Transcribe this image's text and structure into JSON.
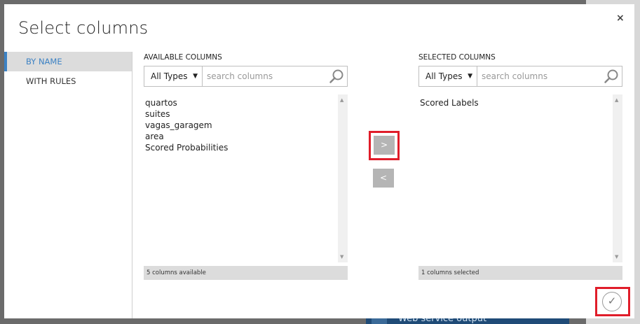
{
  "dialog": {
    "title": "Select columns",
    "close_glyph": "×"
  },
  "sidebar": {
    "items": [
      {
        "label": "BY NAME",
        "active": true
      },
      {
        "label": "WITH RULES",
        "active": false
      }
    ]
  },
  "available": {
    "heading": "AVAILABLE COLUMNS",
    "type_filter": "All Types",
    "search_placeholder": "search columns",
    "items": [
      "quartos",
      "suites",
      "vagas_garagem",
      "area",
      "Scored Probabilities"
    ],
    "status": "5 columns available"
  },
  "selected": {
    "heading": "SELECTED COLUMNS",
    "type_filter": "All Types",
    "search_placeholder": "search columns",
    "items": [
      "Scored Labels"
    ],
    "status": "1 columns selected"
  },
  "controls": {
    "add_label": ">",
    "remove_label": "<",
    "ok_glyph": "✓"
  },
  "background": {
    "tile_text": "Web service output"
  },
  "colors": {
    "accent": "#3c82c4",
    "highlight": "#e01d2a",
    "move_button": "#b5b5b5"
  },
  "icons": {
    "search": "search-icon",
    "caret": "chevron-down-icon",
    "close": "close-icon",
    "ok": "checkmark-icon"
  }
}
